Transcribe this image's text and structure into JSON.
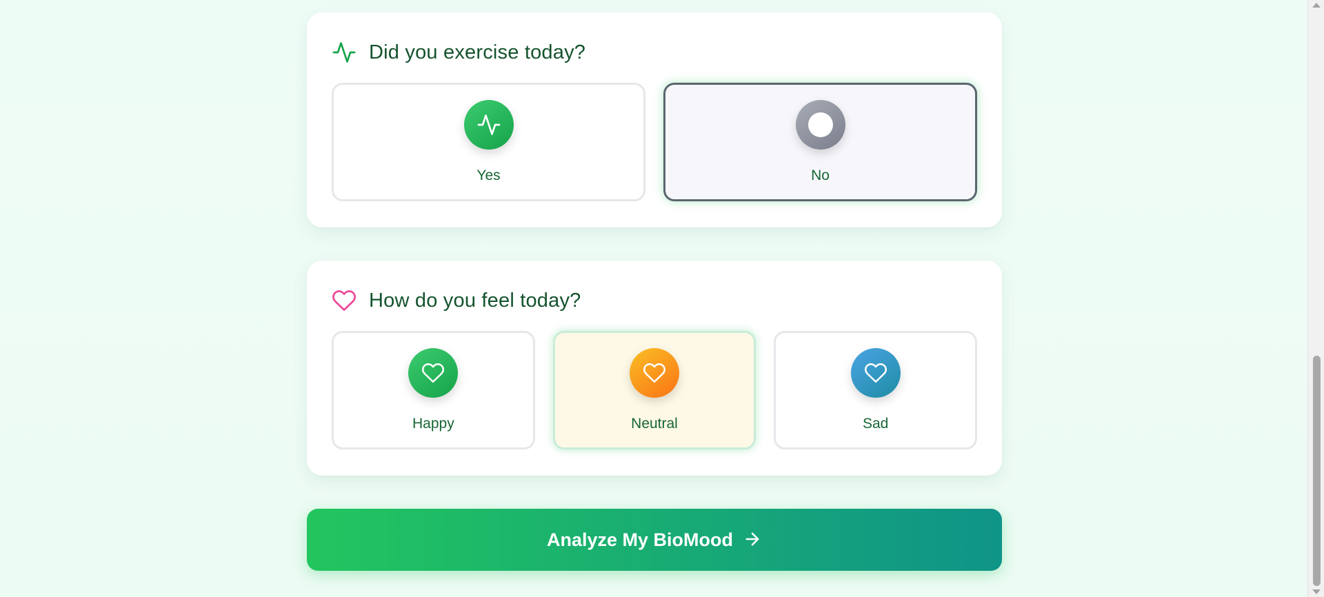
{
  "exercise": {
    "title": "Did you exercise today?",
    "header_icon": "activity-icon",
    "options": [
      {
        "label": "Yes",
        "icon": "activity-icon",
        "selected": false
      },
      {
        "label": "No",
        "icon": "circle-icon",
        "selected": true
      }
    ]
  },
  "mood": {
    "title": "How do you feel today?",
    "header_icon": "heart-icon",
    "options": [
      {
        "label": "Happy",
        "icon": "heart-icon",
        "selected": false
      },
      {
        "label": "Neutral",
        "icon": "heart-icon",
        "selected": true
      },
      {
        "label": "Sad",
        "icon": "heart-icon",
        "selected": false
      }
    ]
  },
  "action": {
    "label": "Analyze My BioMood",
    "icon": "arrow-right-icon"
  },
  "colors": {
    "title": "#14532d",
    "primary_green": "#22c55e",
    "teal": "#0f9488",
    "header_heart": "#ec4899"
  }
}
